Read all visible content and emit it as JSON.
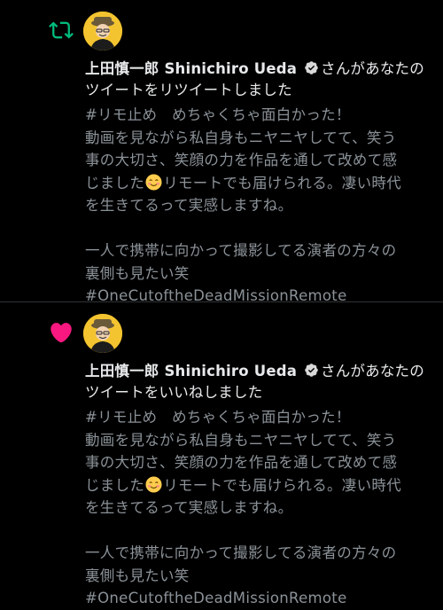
{
  "notifications": [
    {
      "type": "retweet",
      "icon": "retweet-icon",
      "icon_color": "#00ba7c",
      "user_name": "上田慎一郎 Shinichiro Ueda",
      "action_text": "さんがあなたのツイートをリツイートしました",
      "tweet": {
        "line1": "#リモ止め　めちゃくちゃ面白かった！",
        "line2": "動画を見ながら私自身もニヤニヤしてて、笑う",
        "line3": "事の大切さ、笑顔の力を作品を通して改めて感",
        "line4a": "じました",
        "line4b": "リモートでも届けられる。凄い時代",
        "line5": "を生きてるって実感しますね。",
        "line6": "一人で携帯に向かって撮影してる演者の方々の",
        "line7": "裏側も見たい笑",
        "line8": "#OneCutoftheDeadMissionRemote"
      }
    },
    {
      "type": "like",
      "icon": "heart-icon",
      "icon_color": "#f91880",
      "user_name": "上田慎一郎 Shinichiro Ueda",
      "action_text": "さんがあなたのツイートをいいねしました",
      "tweet": {
        "line1": "#リモ止め　めちゃくちゃ面白かった！",
        "line2": "動画を見ながら私自身もニヤニヤしてて、笑う",
        "line3": "事の大切さ、笑顔の力を作品を通して改めて感",
        "line4a": "じました",
        "line4b": "リモートでも届けられる。凄い時代",
        "line5": "を生きてるって実感しますね。",
        "line6": "一人で携帯に向かって撮影してる演者の方々の",
        "line7": "裏側も見たい笑",
        "line8": "#OneCutoftheDeadMissionRemote"
      }
    }
  ],
  "emoji_name": "smiling-face-emoji",
  "verified_icon": "verified-badge-icon"
}
